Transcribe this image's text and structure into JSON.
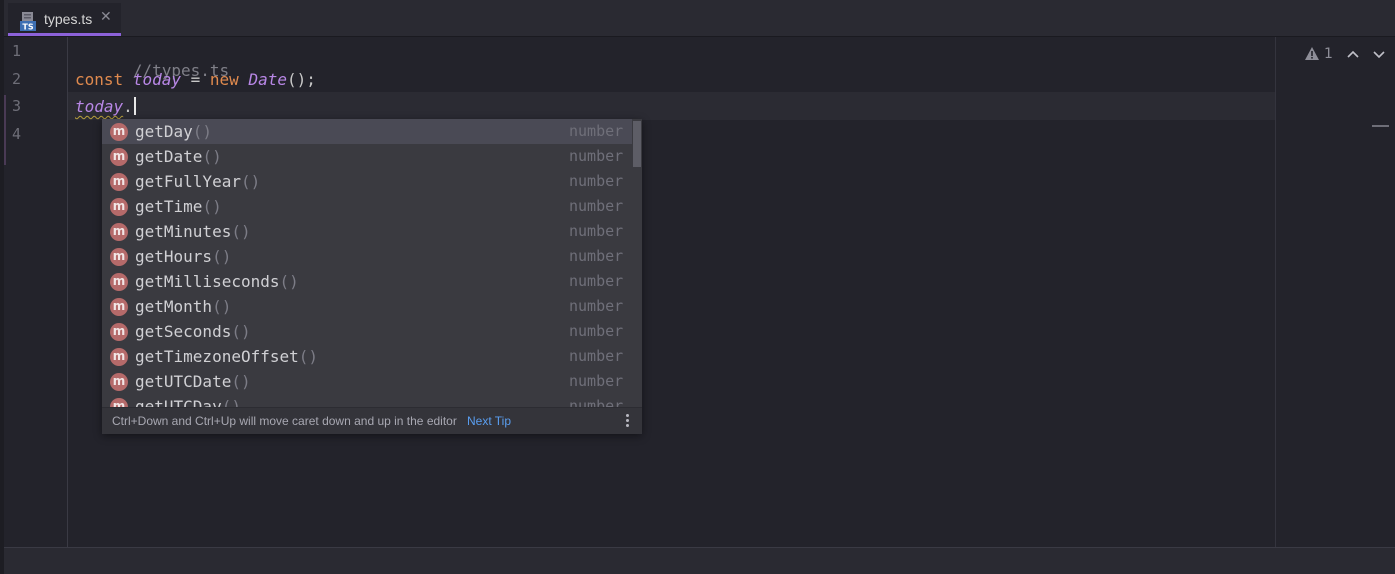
{
  "tab": {
    "icon": "typescript-file-icon",
    "icon_text": "TS",
    "label": "types.ts",
    "close": "✕"
  },
  "gutter": {
    "line_numbers": [
      "1",
      "2",
      "3",
      "4"
    ]
  },
  "code": {
    "line1": {
      "comment": "//types.ts"
    },
    "line2": {
      "kw1": "const",
      "var": "today",
      "op": "=",
      "kw2": "new",
      "cls": "Date",
      "punc": "();"
    },
    "line3": {
      "var": "today",
      "dot": "."
    }
  },
  "inspection": {
    "icon": "warning-icon",
    "count": "1",
    "prev_icon": "chevron-up-icon",
    "next_icon": "chevron-down-icon"
  },
  "completion": {
    "items": [
      {
        "name": "getDay",
        "parens": "()",
        "type": "number",
        "badge": "m"
      },
      {
        "name": "getDate",
        "parens": "()",
        "type": "number",
        "badge": "m"
      },
      {
        "name": "getFullYear",
        "parens": "()",
        "type": "number",
        "badge": "m"
      },
      {
        "name": "getTime",
        "parens": "()",
        "type": "number",
        "badge": "m"
      },
      {
        "name": "getMinutes",
        "parens": "()",
        "type": "number",
        "badge": "m"
      },
      {
        "name": "getHours",
        "parens": "()",
        "type": "number",
        "badge": "m"
      },
      {
        "name": "getMilliseconds",
        "parens": "()",
        "type": "number",
        "badge": "m"
      },
      {
        "name": "getMonth",
        "parens": "()",
        "type": "number",
        "badge": "m"
      },
      {
        "name": "getSeconds",
        "parens": "()",
        "type": "number",
        "badge": "m"
      },
      {
        "name": "getTimezoneOffset",
        "parens": "()",
        "type": "number",
        "badge": "m"
      },
      {
        "name": "getUTCDate",
        "parens": "()",
        "type": "number",
        "badge": "m"
      },
      {
        "name": "getUTCDay",
        "parens": "()",
        "type": "number",
        "badge": "m"
      }
    ],
    "selected_index": 0,
    "footer_tip": "Ctrl+Down and Ctrl+Up will move caret down and up in the editor",
    "footer_link": "Next Tip",
    "menu_icon": "kebab-menu-icon"
  },
  "colors": {
    "accent_tab_underline": "#8c62d9",
    "keyword": "#e08a4e",
    "identifier": "#b887e6",
    "method_badge": "#b56a6a",
    "link": "#5a9ef0"
  }
}
